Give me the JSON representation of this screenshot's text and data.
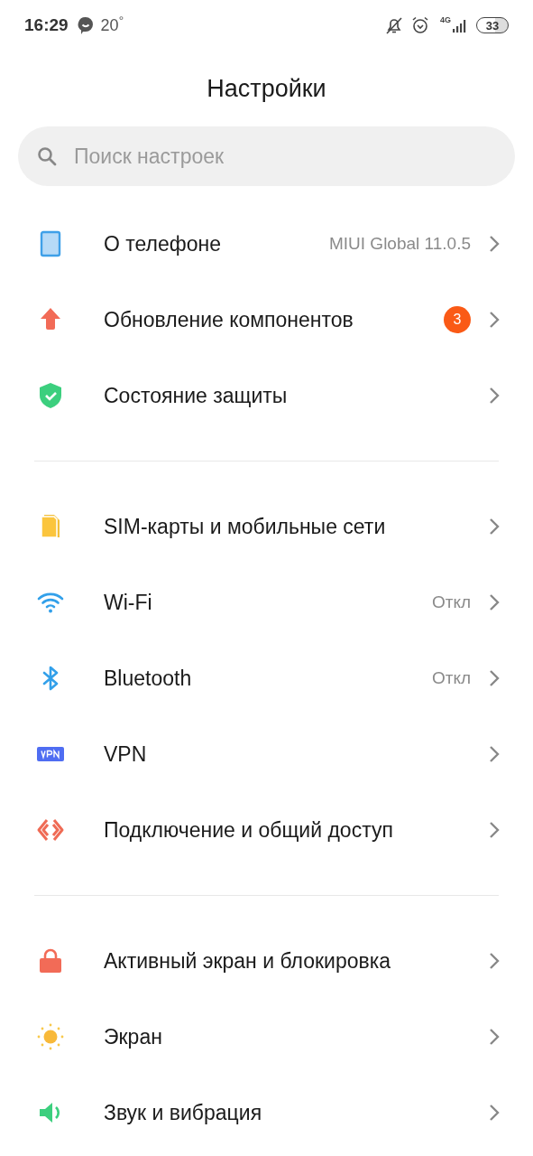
{
  "status_bar": {
    "time": "16:29",
    "temperature": "20$^{°}$",
    "network": "4G",
    "battery": "33"
  },
  "title": "Настройки",
  "search": {
    "placeholder": "Поиск настроек"
  },
  "sections": [
    {
      "items": [
        {
          "label": "О телефоне",
          "value": "MIUI Global 11.0.5"
        },
        {
          "label": "Обновление компонентов",
          "badge": "3"
        },
        {
          "label": "Состояние защиты"
        }
      ]
    },
    {
      "items": [
        {
          "label": "SIM-карты и мобильные сети"
        },
        {
          "label": "Wi-Fi",
          "value": "Откл"
        },
        {
          "label": "Bluetooth",
          "value": "Откл"
        },
        {
          "label": "VPN"
        },
        {
          "label": "Подключение и общий доступ"
        }
      ]
    },
    {
      "items": [
        {
          "label": "Активный экран и блокировка"
        },
        {
          "label": "Экран"
        },
        {
          "label": "Звук и вибрация"
        }
      ]
    }
  ]
}
